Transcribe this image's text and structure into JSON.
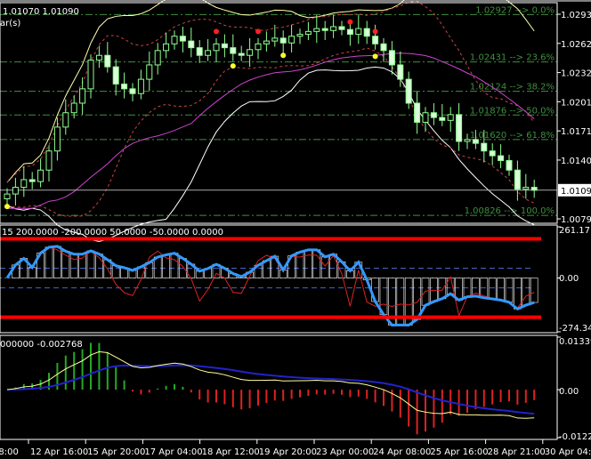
{
  "colors": {
    "background": "#000000",
    "bull": "#90ff90",
    "bear": "#d8ffd8",
    "fib": "#3f8f3f",
    "cci": "#3399ff",
    "level": "#ff0000",
    "signal": "#2222cc",
    "macd_line": "#ffff99"
  },
  "main_header": {
    "values": "1.01070 1.01090",
    "subtitle": "ar(s)"
  },
  "cci_header": "15 200.0000 -200.0000 50.0000 -50.0000 0.0000",
  "macd_header": "000000 -0.002768",
  "price_axis": [
    "1.02930",
    "1.02625",
    "1.02320",
    "1.02015",
    "1.01710",
    "1.01405",
    "1.00790"
  ],
  "current_price": "1.01090",
  "cci_axis": [
    "261.1714",
    "0.00",
    "-274.341"
  ],
  "macd_axis": [
    "0.013391",
    "0.00",
    "-0.01223"
  ],
  "time_axis": [
    "08:00",
    "12 Apr 16:00",
    "15 Apr 20:00",
    "17 Apr 04:00",
    "18 Apr 12:00",
    "19 Apr 20:00",
    "23 Apr 00:00",
    "24 Apr 08:00",
    "25 Apr 16:00",
    "28 Apr 21:00",
    "30 Apr 04:00"
  ],
  "fib_labels": [
    "1.02927 --> 0.0%",
    "1.02431 --> 23.6%",
    "1.02124 --> 38.2%",
    "1.01876 --> 50.0%",
    "1.01620 --> 61.8%",
    "1.00826 --> 100.0%"
  ],
  "chart_data": {
    "type": "candlestick",
    "title": "EURUSD-like price with Bollinger bands, fractals, Fibonacci, CCI and MACD",
    "fib_levels": [
      1.02927,
      1.02431,
      1.02124,
      1.01876,
      1.0162,
      1.00826
    ],
    "ylim": [
      1.00744,
      1.0304
    ],
    "closes": [
      1.0105,
      1.0112,
      1.012,
      1.0118,
      1.013,
      1.015,
      1.0175,
      1.019,
      1.02,
      1.0215,
      1.0245,
      1.025,
      1.0238,
      1.022,
      1.0215,
      1.021,
      1.0225,
      1.024,
      1.0255,
      1.0262,
      1.027,
      1.0265,
      1.0258,
      1.025,
      1.0255,
      1.0262,
      1.0258,
      1.0252,
      1.025,
      1.0256,
      1.0262,
      1.0265,
      1.0268,
      1.0263,
      1.027,
      1.0272,
      1.0275,
      1.0278,
      1.0276,
      1.028,
      1.0277,
      1.0272,
      1.0278,
      1.027,
      1.0262,
      1.0255,
      1.024,
      1.0225,
      1.02,
      1.018,
      1.019,
      1.0185,
      1.0182,
      1.0188,
      1.016,
      1.0162,
      1.0158,
      1.015,
      1.0145,
      1.014,
      1.013,
      1.011,
      1.0112,
      1.0109
    ],
    "fractals_up": [
      25,
      30,
      41,
      44
    ],
    "fractals_down": [
      0,
      27,
      33,
      44
    ],
    "cci_levels": [
      200,
      -200,
      50,
      -50,
      0
    ],
    "cci_ylim": [
      -274.341,
      261.1714
    ],
    "macd_ylim": [
      -0.01223,
      0.013391
    ]
  }
}
